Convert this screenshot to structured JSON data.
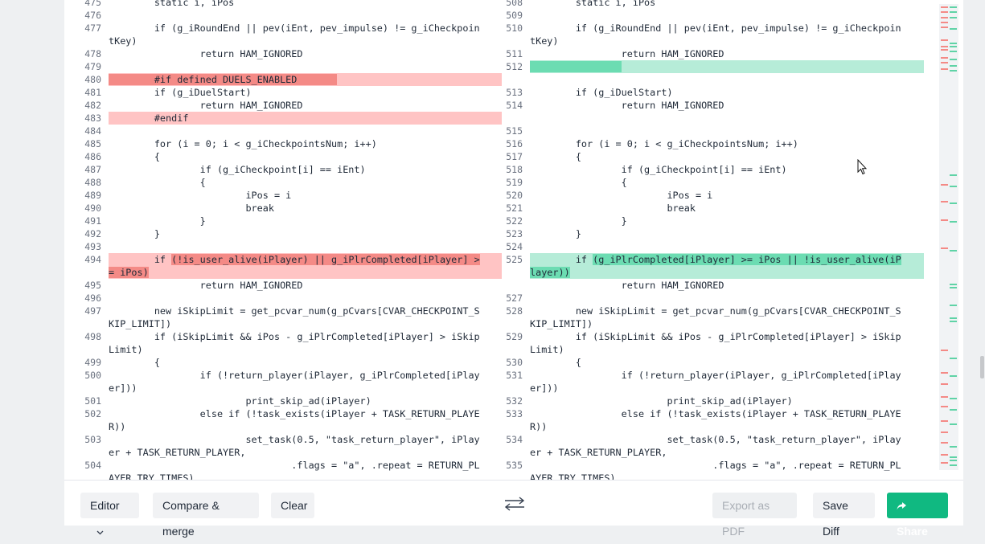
{
  "diff": {
    "left": [
      {
        "n": "475",
        "t": "        static i, iPos",
        "k": "n"
      },
      {
        "n": "476",
        "t": "",
        "k": "n"
      },
      {
        "n": "477",
        "t": "        if (g_iRoundEnd || pev(iEnt, pev_impulse) != g_iCheckpoin",
        "k": "n"
      },
      {
        "n": "",
        "t": "tKey)",
        "k": "n"
      },
      {
        "n": "478",
        "t": "                return HAM_IGNORED",
        "k": "n"
      },
      {
        "n": "479",
        "t": "",
        "k": "d"
      },
      {
        "n": "480",
        "t": "",
        "k": "d",
        "p": "",
        "h": "        #if defined DUELS_ENABLED       ",
        "s": ""
      },
      {
        "n": "481",
        "t": "        if (g_iDuelStart)",
        "k": "n"
      },
      {
        "n": "482",
        "t": "                return HAM_IGNORED",
        "k": "n"
      },
      {
        "n": "483",
        "t": "        #endif",
        "k": "d"
      },
      {
        "n": "484",
        "t": "",
        "k": "n"
      },
      {
        "n": "485",
        "t": "        for (i = 0; i < g_iCheckpointsNum; i++)",
        "k": "n"
      },
      {
        "n": "486",
        "t": "        {",
        "k": "n"
      },
      {
        "n": "487",
        "t": "                if (g_iCheckpoint[i] == iEnt)",
        "k": "n"
      },
      {
        "n": "488",
        "t": "                {",
        "k": "n"
      },
      {
        "n": "489",
        "t": "                        iPos = i",
        "k": "n"
      },
      {
        "n": "490",
        "t": "                        break",
        "k": "n"
      },
      {
        "n": "491",
        "t": "                }",
        "k": "n"
      },
      {
        "n": "492",
        "t": "        }",
        "k": "n"
      },
      {
        "n": "493",
        "t": "",
        "k": "n"
      },
      {
        "n": "494",
        "t": "",
        "k": "d",
        "p": "        if ",
        "h": "(!is_user_alive(iPlayer) || g_iPlrCompleted[iPlayer] >",
        "s": ""
      },
      {
        "n": "",
        "t": "",
        "k": "d",
        "p": "",
        "h": "= iPos)",
        "s": ""
      },
      {
        "n": "495",
        "t": "                return HAM_IGNORED",
        "k": "n"
      },
      {
        "n": "496",
        "t": "",
        "k": "n"
      },
      {
        "n": "497",
        "t": "        new iSkipLimit = get_pcvar_num(g_pCvars[CVAR_CHECKPOINT_S",
        "k": "n"
      },
      {
        "n": "",
        "t": "KIP_LIMIT])",
        "k": "n"
      },
      {
        "n": "498",
        "t": "        if (iSkipLimit && iPos - g_iPlrCompleted[iPlayer] > iSkip",
        "k": "n"
      },
      {
        "n": "",
        "t": "Limit)",
        "k": "n"
      },
      {
        "n": "499",
        "t": "        {",
        "k": "n"
      },
      {
        "n": "500",
        "t": "                if (!return_player(iPlayer, g_iPlrCompleted[iPlay",
        "k": "n"
      },
      {
        "n": "",
        "t": "er]))",
        "k": "n"
      },
      {
        "n": "501",
        "t": "                        print_skip_ad(iPlayer)",
        "k": "n"
      },
      {
        "n": "502",
        "t": "                else if (!task_exists(iPlayer + TASK_RETURN_PLAYE",
        "k": "n"
      },
      {
        "n": "",
        "t": "R))",
        "k": "n"
      },
      {
        "n": "503",
        "t": "                        set_task(0.5, \"task_return_player\", iPlay",
        "k": "n"
      },
      {
        "n": "",
        "t": "er + TASK_RETURN_PLAYER,",
        "k": "n"
      },
      {
        "n": "504",
        "t": "                                .flags = \"a\", .repeat = RETURN_PL",
        "k": "n"
      },
      {
        "n": "",
        "t": "AYER_TRY_TIMES)",
        "k": "n"
      }
    ],
    "right": [
      {
        "n": "508",
        "t": "        static i, iPos",
        "k": "n"
      },
      {
        "n": "509",
        "t": "",
        "k": "n"
      },
      {
        "n": "510",
        "t": "        if (g_iRoundEnd || pev(iEnt, pev_impulse) != g_iCheckpoin",
        "k": "n"
      },
      {
        "n": "",
        "t": "tKey)",
        "k": "n"
      },
      {
        "n": "511",
        "t": "                return HAM_IGNORED",
        "k": "n"
      },
      {
        "n": "512",
        "t": "",
        "k": "a",
        "p": "",
        "h": "                ",
        "s": ""
      },
      {
        "n": "",
        "t": "",
        "k": "e"
      },
      {
        "n": "513",
        "t": "        if (g_iDuelStart)",
        "k": "n"
      },
      {
        "n": "514",
        "t": "                return HAM_IGNORED",
        "k": "n"
      },
      {
        "n": "",
        "t": "",
        "k": "e"
      },
      {
        "n": "515",
        "t": "",
        "k": "n"
      },
      {
        "n": "516",
        "t": "        for (i = 0; i < g_iCheckpointsNum; i++)",
        "k": "n"
      },
      {
        "n": "517",
        "t": "        {",
        "k": "n"
      },
      {
        "n": "518",
        "t": "                if (g_iCheckpoint[i] == iEnt)",
        "k": "n"
      },
      {
        "n": "519",
        "t": "                {",
        "k": "n"
      },
      {
        "n": "520",
        "t": "                        iPos = i",
        "k": "n"
      },
      {
        "n": "521",
        "t": "                        break",
        "k": "n"
      },
      {
        "n": "522",
        "t": "                }",
        "k": "n"
      },
      {
        "n": "523",
        "t": "        }",
        "k": "n"
      },
      {
        "n": "524",
        "t": "",
        "k": "n"
      },
      {
        "n": "525",
        "t": "",
        "k": "a",
        "p": "        if ",
        "h": "(g_iPlrCompleted[iPlayer] >= iPos || !is_user_alive(iP",
        "s": ""
      },
      {
        "n": "",
        "t": "",
        "k": "a",
        "p": "",
        "h": "layer))",
        "s": ""
      },
      {
        "n": "",
        "t": "                return HAM_IGNORED",
        "k": "n"
      },
      {
        "n": "527",
        "t": "",
        "k": "n"
      },
      {
        "n": "528",
        "t": "        new iSkipLimit = get_pcvar_num(g_pCvars[CVAR_CHECKPOINT_S",
        "k": "n"
      },
      {
        "n": "",
        "t": "KIP_LIMIT])",
        "k": "n"
      },
      {
        "n": "529",
        "t": "        if (iSkipLimit && iPos - g_iPlrCompleted[iPlayer] > iSkip",
        "k": "n"
      },
      {
        "n": "",
        "t": "Limit)",
        "k": "n"
      },
      {
        "n": "530",
        "t": "        {",
        "k": "n"
      },
      {
        "n": "531",
        "t": "                if (!return_player(iPlayer, g_iPlrCompleted[iPlay",
        "k": "n"
      },
      {
        "n": "",
        "t": "er]))",
        "k": "n"
      },
      {
        "n": "532",
        "t": "                        print_skip_ad(iPlayer)",
        "k": "n"
      },
      {
        "n": "533",
        "t": "                else if (!task_exists(iPlayer + TASK_RETURN_PLAYE",
        "k": "n"
      },
      {
        "n": "",
        "t": "R))",
        "k": "n"
      },
      {
        "n": "534",
        "t": "                        set_task(0.5, \"task_return_player\", iPlay",
        "k": "n"
      },
      {
        "n": "",
        "t": "er + TASK_RETURN_PLAYER,",
        "k": "n"
      },
      {
        "n": "535",
        "t": "                                .flags = \"a\", .repeat = RETURN_PL",
        "k": "n"
      },
      {
        "n": "",
        "t": "AYER_TRY_TIMES)",
        "k": "n"
      }
    ]
  },
  "toolbar": {
    "editor_label": "Editor",
    "compare_label": "Compare & merge",
    "clear_label": "Clear",
    "swap_icon": "swap-arrows-icon",
    "export_label": "Export as PDF",
    "save_label": "Save Diff",
    "share_label": "Share",
    "share_icon": "share-arrow-icon"
  },
  "colors": {
    "removed_line": "#ffc4c4",
    "removed_highlight": "#f48a86",
    "added_line": "#b6ecd8",
    "added_highlight": "#6cdcb2",
    "empty_line": "#eceef0",
    "primary": "#10b981"
  }
}
